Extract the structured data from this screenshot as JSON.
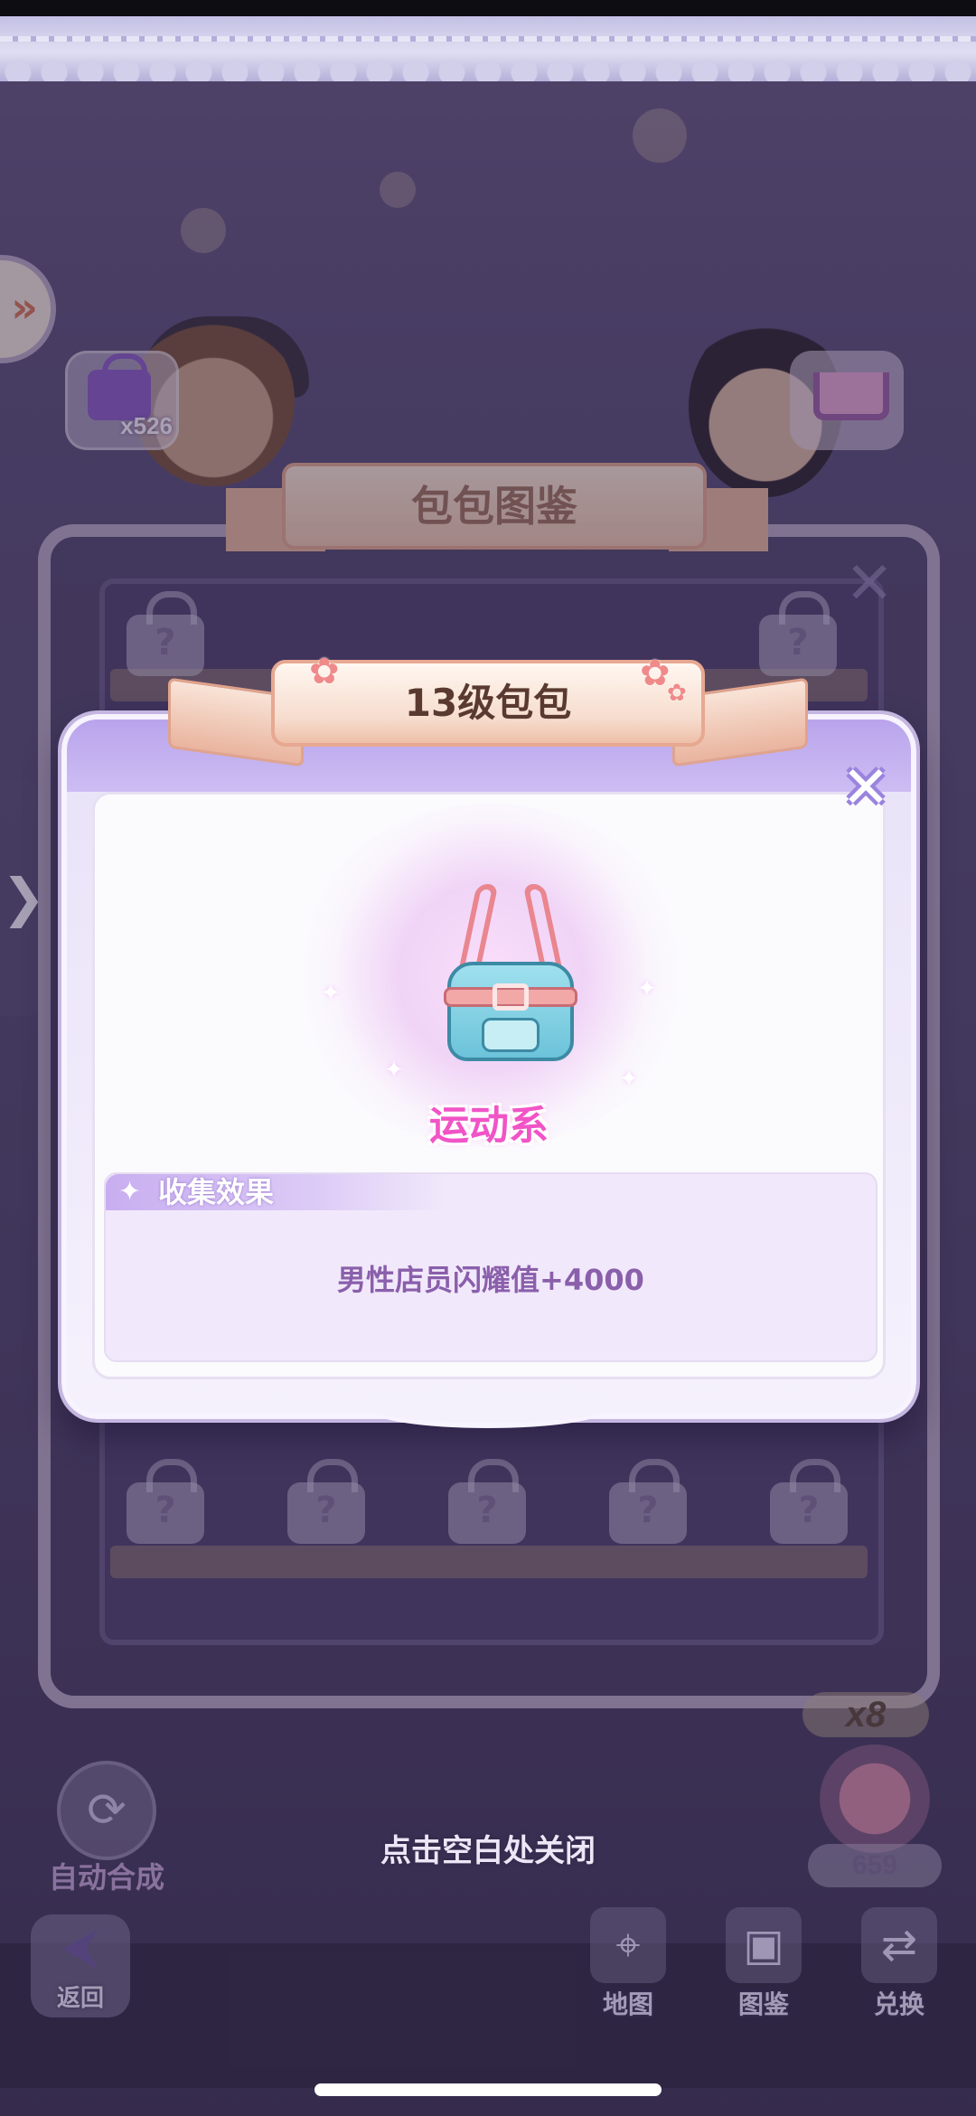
{
  "background": {
    "bag_count": "x526",
    "album_title": "包包图鉴",
    "multiplier": "x8",
    "coin_count": "659",
    "auto_merge_label": "自动合成",
    "back_label": "返回",
    "nav": {
      "map_label": "地图",
      "album_label": "图鉴",
      "exchange_label": "兑换"
    },
    "side_expand_glyph": "»",
    "side_arrow_glyph": "❯"
  },
  "modal": {
    "title": "13级包包",
    "category": "运动系",
    "effect_section_label": "收集效果",
    "effect_text": "男性店员闪耀值+4000",
    "close_glyph": "✕"
  },
  "tap_hint": "点击空白处关闭",
  "icons": {
    "bag-item": "blue-handbag-icon",
    "close": "close-icon",
    "star": "sparkle-icon"
  },
  "colors": {
    "category_pink": "#f154c7",
    "effect_purple": "#8a5fab",
    "modal_band": "#b9a4ec"
  }
}
